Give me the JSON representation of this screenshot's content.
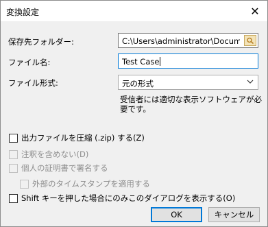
{
  "window": {
    "title": "変換設定",
    "close_glyph": "✕"
  },
  "form": {
    "folder_label": "保存先フォルダー:",
    "folder_value": "C:\\Users\\administrator\\Documents",
    "filename_label": "ファイル名:",
    "filename_value": "Test Case",
    "format_label": "ファイル形式:",
    "format_value": "元の形式",
    "format_note": "受信者には適切な表示ソフトウェアが必要です。"
  },
  "options": [
    {
      "label": "出力ファイルを圧縮 (.zip) する(Z)",
      "checked": false,
      "enabled": true
    },
    {
      "label": "注釈を含めない(D)",
      "checked": false,
      "enabled": false
    },
    {
      "label": "個人の証明書で署名する",
      "checked": false,
      "enabled": false
    },
    {
      "label": "外部のタイムスタンプを適用する",
      "checked": false,
      "enabled": false
    },
    {
      "label": "Shift キーを押した場合にのみこのダイアログを表示する(O)",
      "checked": false,
      "enabled": true
    }
  ],
  "buttons": {
    "ok": "OK",
    "cancel": "キャンセル"
  },
  "icons": {
    "browse": "folder-icon",
    "dropdown": "chevron-down-icon",
    "close": "close-icon"
  },
  "colors": {
    "focus_border": "#0078d7",
    "dialog_bg": "#f0f0f0",
    "disabled_text": "#8d8d8d"
  }
}
